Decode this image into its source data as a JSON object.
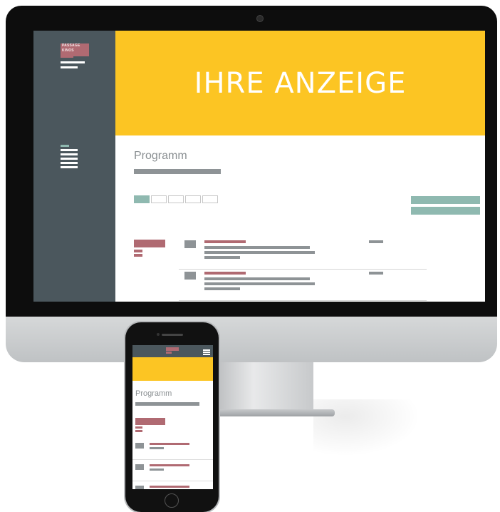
{
  "desktop": {
    "logo_text": "PASSAGE KINOS",
    "hero_title": "IHRE ANZEIGE",
    "section_title": "Programm"
  },
  "mobile": {
    "section_title": "Programm"
  },
  "colors": {
    "sidebar": "#4b575d",
    "hero": "#fcc523",
    "accent_red": "#b06a72",
    "accent_teal": "#8fb9b0",
    "placeholder_gray": "#8e9396"
  }
}
